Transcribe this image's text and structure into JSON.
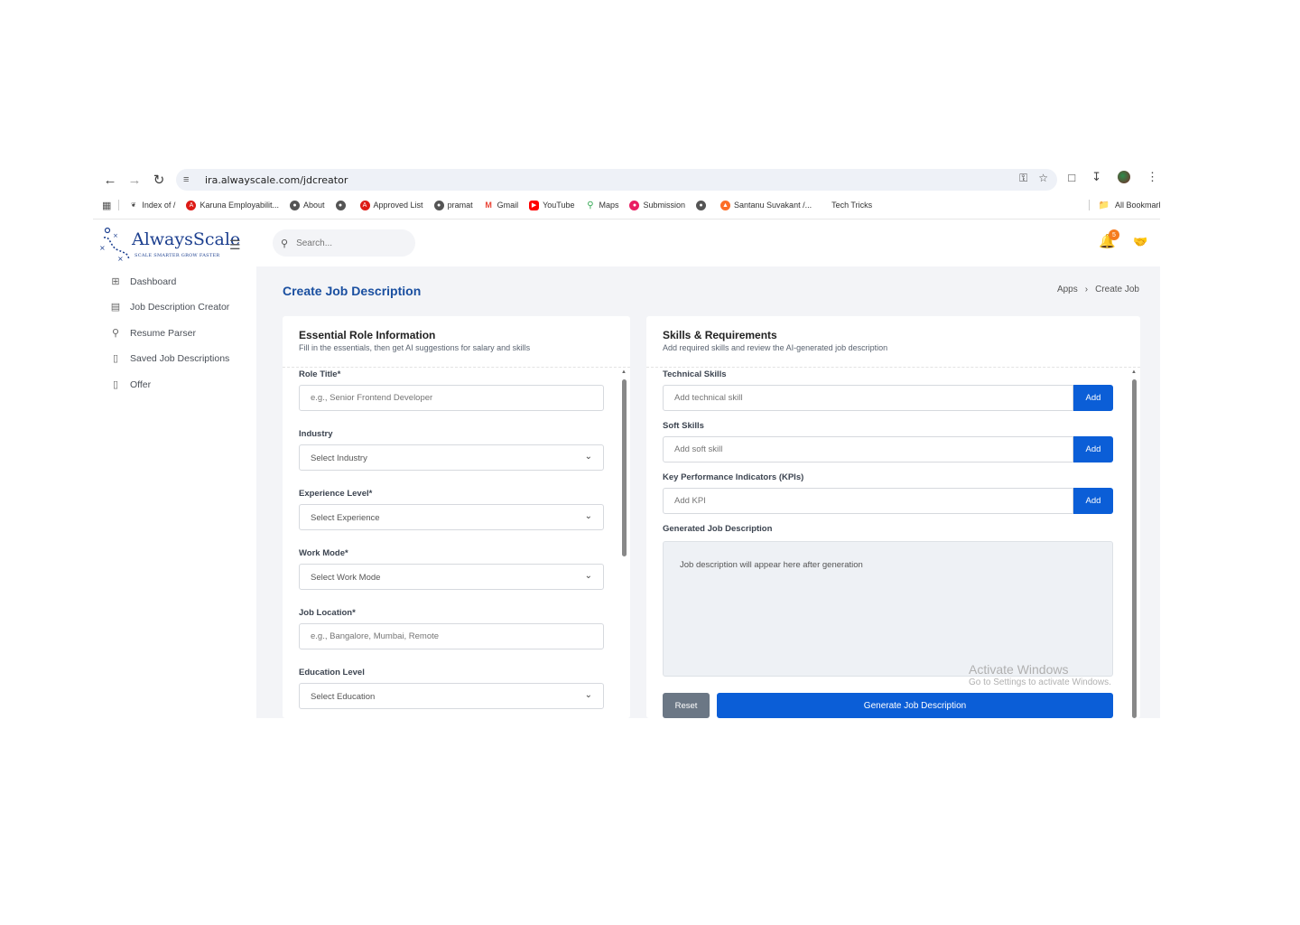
{
  "browser": {
    "url": "ira.alwayscale.com/jdcreator",
    "bookmarks": [
      {
        "label": "Index of /",
        "icon": "leaf-icon",
        "color": "#444444"
      },
      {
        "label": "Karuna Employabilit...",
        "icon": "angular-icon",
        "color": "#dd1b16"
      },
      {
        "label": "About",
        "icon": "globe-icon",
        "color": "#555555"
      },
      {
        "label": "",
        "icon": "globe-icon",
        "color": "#555555"
      },
      {
        "label": "Approved List",
        "icon": "angular-icon",
        "color": "#dd1b16"
      },
      {
        "label": "pramat",
        "icon": "globe-icon",
        "color": "#555555"
      },
      {
        "label": "Gmail",
        "icon": "gmail-icon",
        "color": "#ea4335"
      },
      {
        "label": "YouTube",
        "icon": "youtube-icon",
        "color": "#ff0000"
      },
      {
        "label": "Maps",
        "icon": "maps-pin-icon",
        "color": "#34a853"
      },
      {
        "label": "Submission",
        "icon": "submission-icon",
        "color": "#e91e63"
      },
      {
        "label": "",
        "icon": "globe-icon",
        "color": "#555555"
      },
      {
        "label": "Santanu Suvakant /...",
        "icon": "gitlab-icon",
        "color": "#fc6d26"
      },
      {
        "label": "Tech Tricks",
        "icon": "",
        "color": ""
      }
    ],
    "all_bookmarks": "All Bookmarks"
  },
  "sidebar": {
    "logo_text": "AlwaysScale",
    "logo_tagline": "SCALE SMARTER GROW FASTER",
    "items": [
      {
        "label": "Dashboard",
        "icon": "grid-icon"
      },
      {
        "label": "Job Description Creator",
        "icon": "document-icon"
      },
      {
        "label": "Resume Parser",
        "icon": "search-icon"
      },
      {
        "label": "Saved Job Descriptions",
        "icon": "bookmark-icon"
      },
      {
        "label": "Offer",
        "icon": "bookmark-icon"
      }
    ]
  },
  "header": {
    "search_placeholder": "Search...",
    "notification_count": "5"
  },
  "page": {
    "title": "Create Job Description",
    "breadcrumb": [
      "Apps",
      "Create Job"
    ]
  },
  "left_card": {
    "title": "Essential Role Information",
    "subtitle": "Fill in the essentials, then get AI suggestions for salary and skills",
    "role_title_label": "Role Title*",
    "role_title_placeholder": "e.g., Senior Frontend Developer",
    "industry_label": "Industry",
    "industry_value": "Select Industry",
    "experience_label": "Experience Level*",
    "experience_value": "Select Experience",
    "work_mode_label": "Work Mode*",
    "work_mode_value": "Select Work Mode",
    "location_label": "Job Location*",
    "location_placeholder": "e.g., Bangalore, Mumbai, Remote",
    "education_label": "Education Level",
    "education_value": "Select Education"
  },
  "right_card": {
    "title": "Skills & Requirements",
    "subtitle": "Add required skills and review the AI-generated job description",
    "technical_label": "Technical Skills",
    "technical_placeholder": "Add technical skill",
    "soft_label": "Soft Skills",
    "soft_placeholder": "Add soft skill",
    "kpi_label": "Key Performance Indicators (KPIs)",
    "kpi_placeholder": "Add KPI",
    "add_label": "Add",
    "generated_label": "Generated Job Description",
    "generated_placeholder": "Job description will appear here after generation",
    "reset_label": "Reset",
    "generate_label": "Generate Job Description"
  },
  "watermark": {
    "title": "Activate Windows",
    "subtitle": "Go to Settings to activate Windows."
  },
  "colors": {
    "primary": "#0b5ed7",
    "title_blue": "#1a4fa0",
    "badge": "#f57c1f",
    "reset": "#6b7785"
  }
}
